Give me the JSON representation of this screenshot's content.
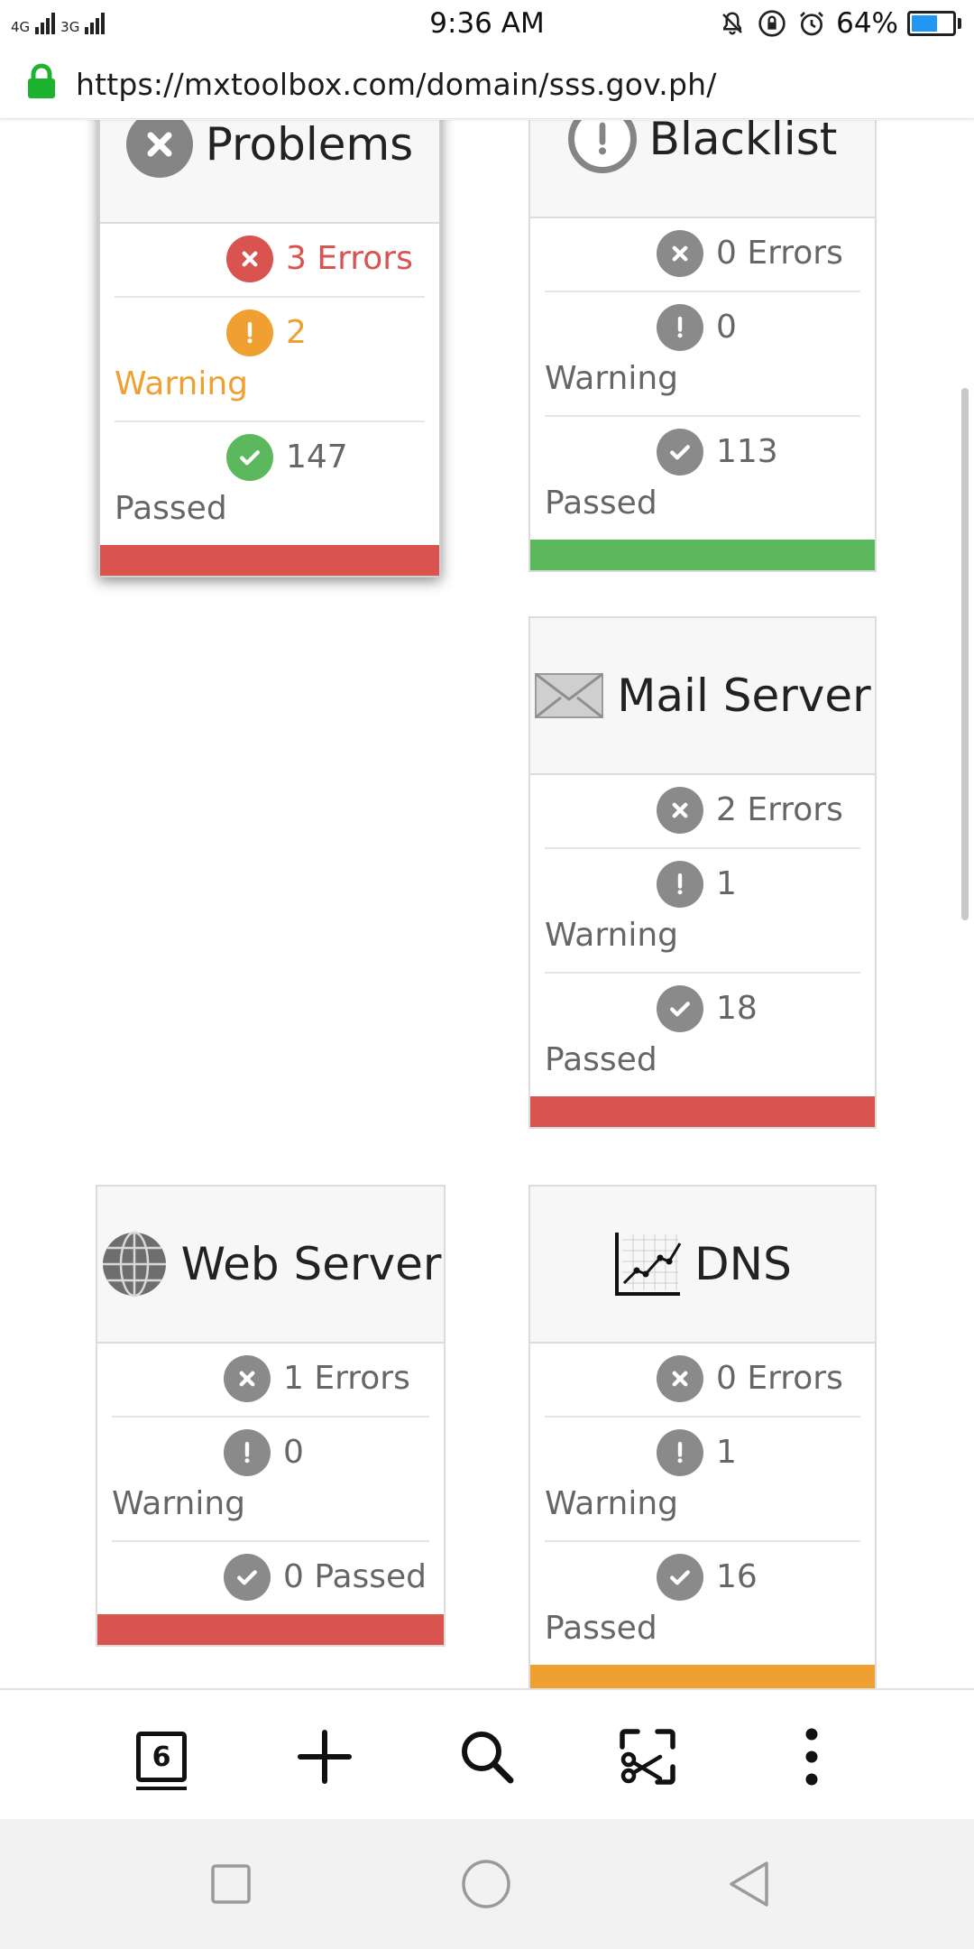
{
  "status_bar": {
    "net_left": "4G",
    "net_right": "3G",
    "time": "9:36 AM",
    "battery": "64%",
    "battery_level": 0.64
  },
  "browser": {
    "url": "https://mxtoolbox.com/domain/sss.gov.ph/",
    "tab_count": "6"
  },
  "colors": {
    "error_red": "#d9534f",
    "warning_orange": "#f0a030",
    "passed_green": "#5cb85c",
    "neutral_gray": "#8a8a8a"
  },
  "cards": {
    "problems": {
      "title": "Problems",
      "errors": "3 Errors",
      "warning_num": "2",
      "warning_label": "Warning",
      "passed_num": "147",
      "passed_label": "Passed",
      "status": "error"
    },
    "blacklist": {
      "title": "Blacklist",
      "errors": "0 Errors",
      "warning_num": "0",
      "warning_label": "Warning",
      "passed_num": "113",
      "passed_label": "Passed",
      "status": "passed"
    },
    "mail_server": {
      "title": "Mail Server",
      "errors": "2 Errors",
      "warning_num": "1",
      "warning_label": "Warning",
      "passed_num": "18",
      "passed_label": "Passed",
      "status": "error"
    },
    "web_server": {
      "title": "Web Server",
      "errors": "1 Errors",
      "warning_num": "0",
      "warning_label": "Warning",
      "passed": "0 Passed",
      "status": "error"
    },
    "dns": {
      "title": "DNS",
      "errors": "0 Errors",
      "warning_num": "1",
      "warning_label": "Warning",
      "passed_num": "16",
      "passed_label": "Passed",
      "status": "warning"
    }
  }
}
